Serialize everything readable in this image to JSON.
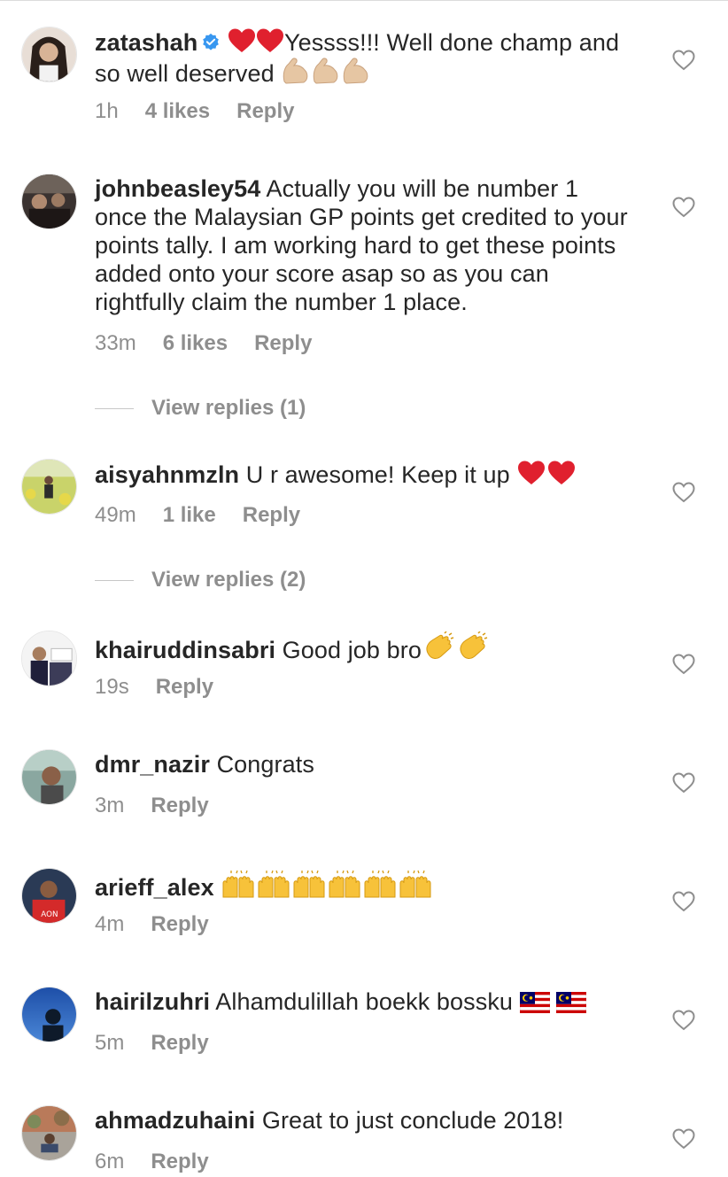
{
  "colors": {
    "text": "#262626",
    "meta": "#8e8e8e",
    "verified_badge": "#3897f0",
    "heart_emoji": "#e0202e"
  },
  "comments": [
    {
      "username": "zatashah",
      "verified": true,
      "text": "Yessss!!! Well done champ and so well deserved",
      "time": "1h",
      "likes": "4 likes",
      "reply": "Reply"
    },
    {
      "username": "johnbeasley54",
      "text": "Actually you will be number 1 once the Malaysian GP points get credited to your points tally. I am working hard to get these points added onto your score asap so as you can rightfully claim the number 1 place.",
      "time": "33m",
      "likes": "6 likes",
      "reply": "Reply",
      "view_replies": "View replies (1)"
    },
    {
      "username": "aisyahnmzln",
      "text": "U r awesome! Keep it up",
      "time": "49m",
      "likes": "1 like",
      "reply": "Reply",
      "view_replies": "View replies (2)"
    },
    {
      "username": "khairuddinsabri",
      "text": "Good job bro",
      "time": "19s",
      "reply": "Reply"
    },
    {
      "username": "dmr_nazir",
      "text": "Congrats",
      "time": "3m",
      "reply": "Reply"
    },
    {
      "username": "arieff_alex",
      "text": "",
      "time": "4m",
      "reply": "Reply"
    },
    {
      "username": "hairilzuhri",
      "text": "Alhamdulillah boekk bossku",
      "time": "5m",
      "reply": "Reply"
    },
    {
      "username": "ahmadzuhaini",
      "text": "Great to just conclude 2018!",
      "time": "6m",
      "reply": "Reply"
    }
  ],
  "icons": {
    "like": "heart-outline-icon",
    "verified": "verified-badge-icon"
  }
}
